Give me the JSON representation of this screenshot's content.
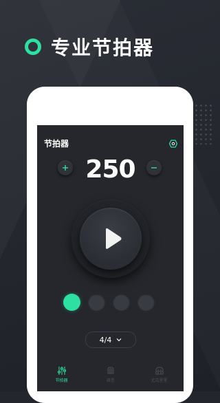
{
  "hero": {
    "title": "专业节拍器"
  },
  "app": {
    "title": "节拍器",
    "settings_icon": "hexagon-settings-icon"
  },
  "tempo": {
    "bpm": "250",
    "increase_icon": "plus-icon",
    "decrease_icon": "minus-icon"
  },
  "player": {
    "icon": "play-icon"
  },
  "beats": [
    {
      "active": true
    },
    {
      "active": false
    },
    {
      "active": false
    },
    {
      "active": false
    }
  ],
  "time_signature": {
    "value": "4/4",
    "icon": "chevron-down-icon"
  },
  "tabs": [
    {
      "label": "节拍器",
      "icon": "sliders-icon",
      "active": true
    },
    {
      "label": "调音",
      "icon": "tuner-icon",
      "active": false
    },
    {
      "label": "尤克里里",
      "icon": "ukulele-icon",
      "active": false
    }
  ],
  "colors": {
    "accent": "#2ee0a1",
    "background": "#23262d",
    "screen": "#25272c",
    "inactive_tab": "#4b4e55"
  }
}
